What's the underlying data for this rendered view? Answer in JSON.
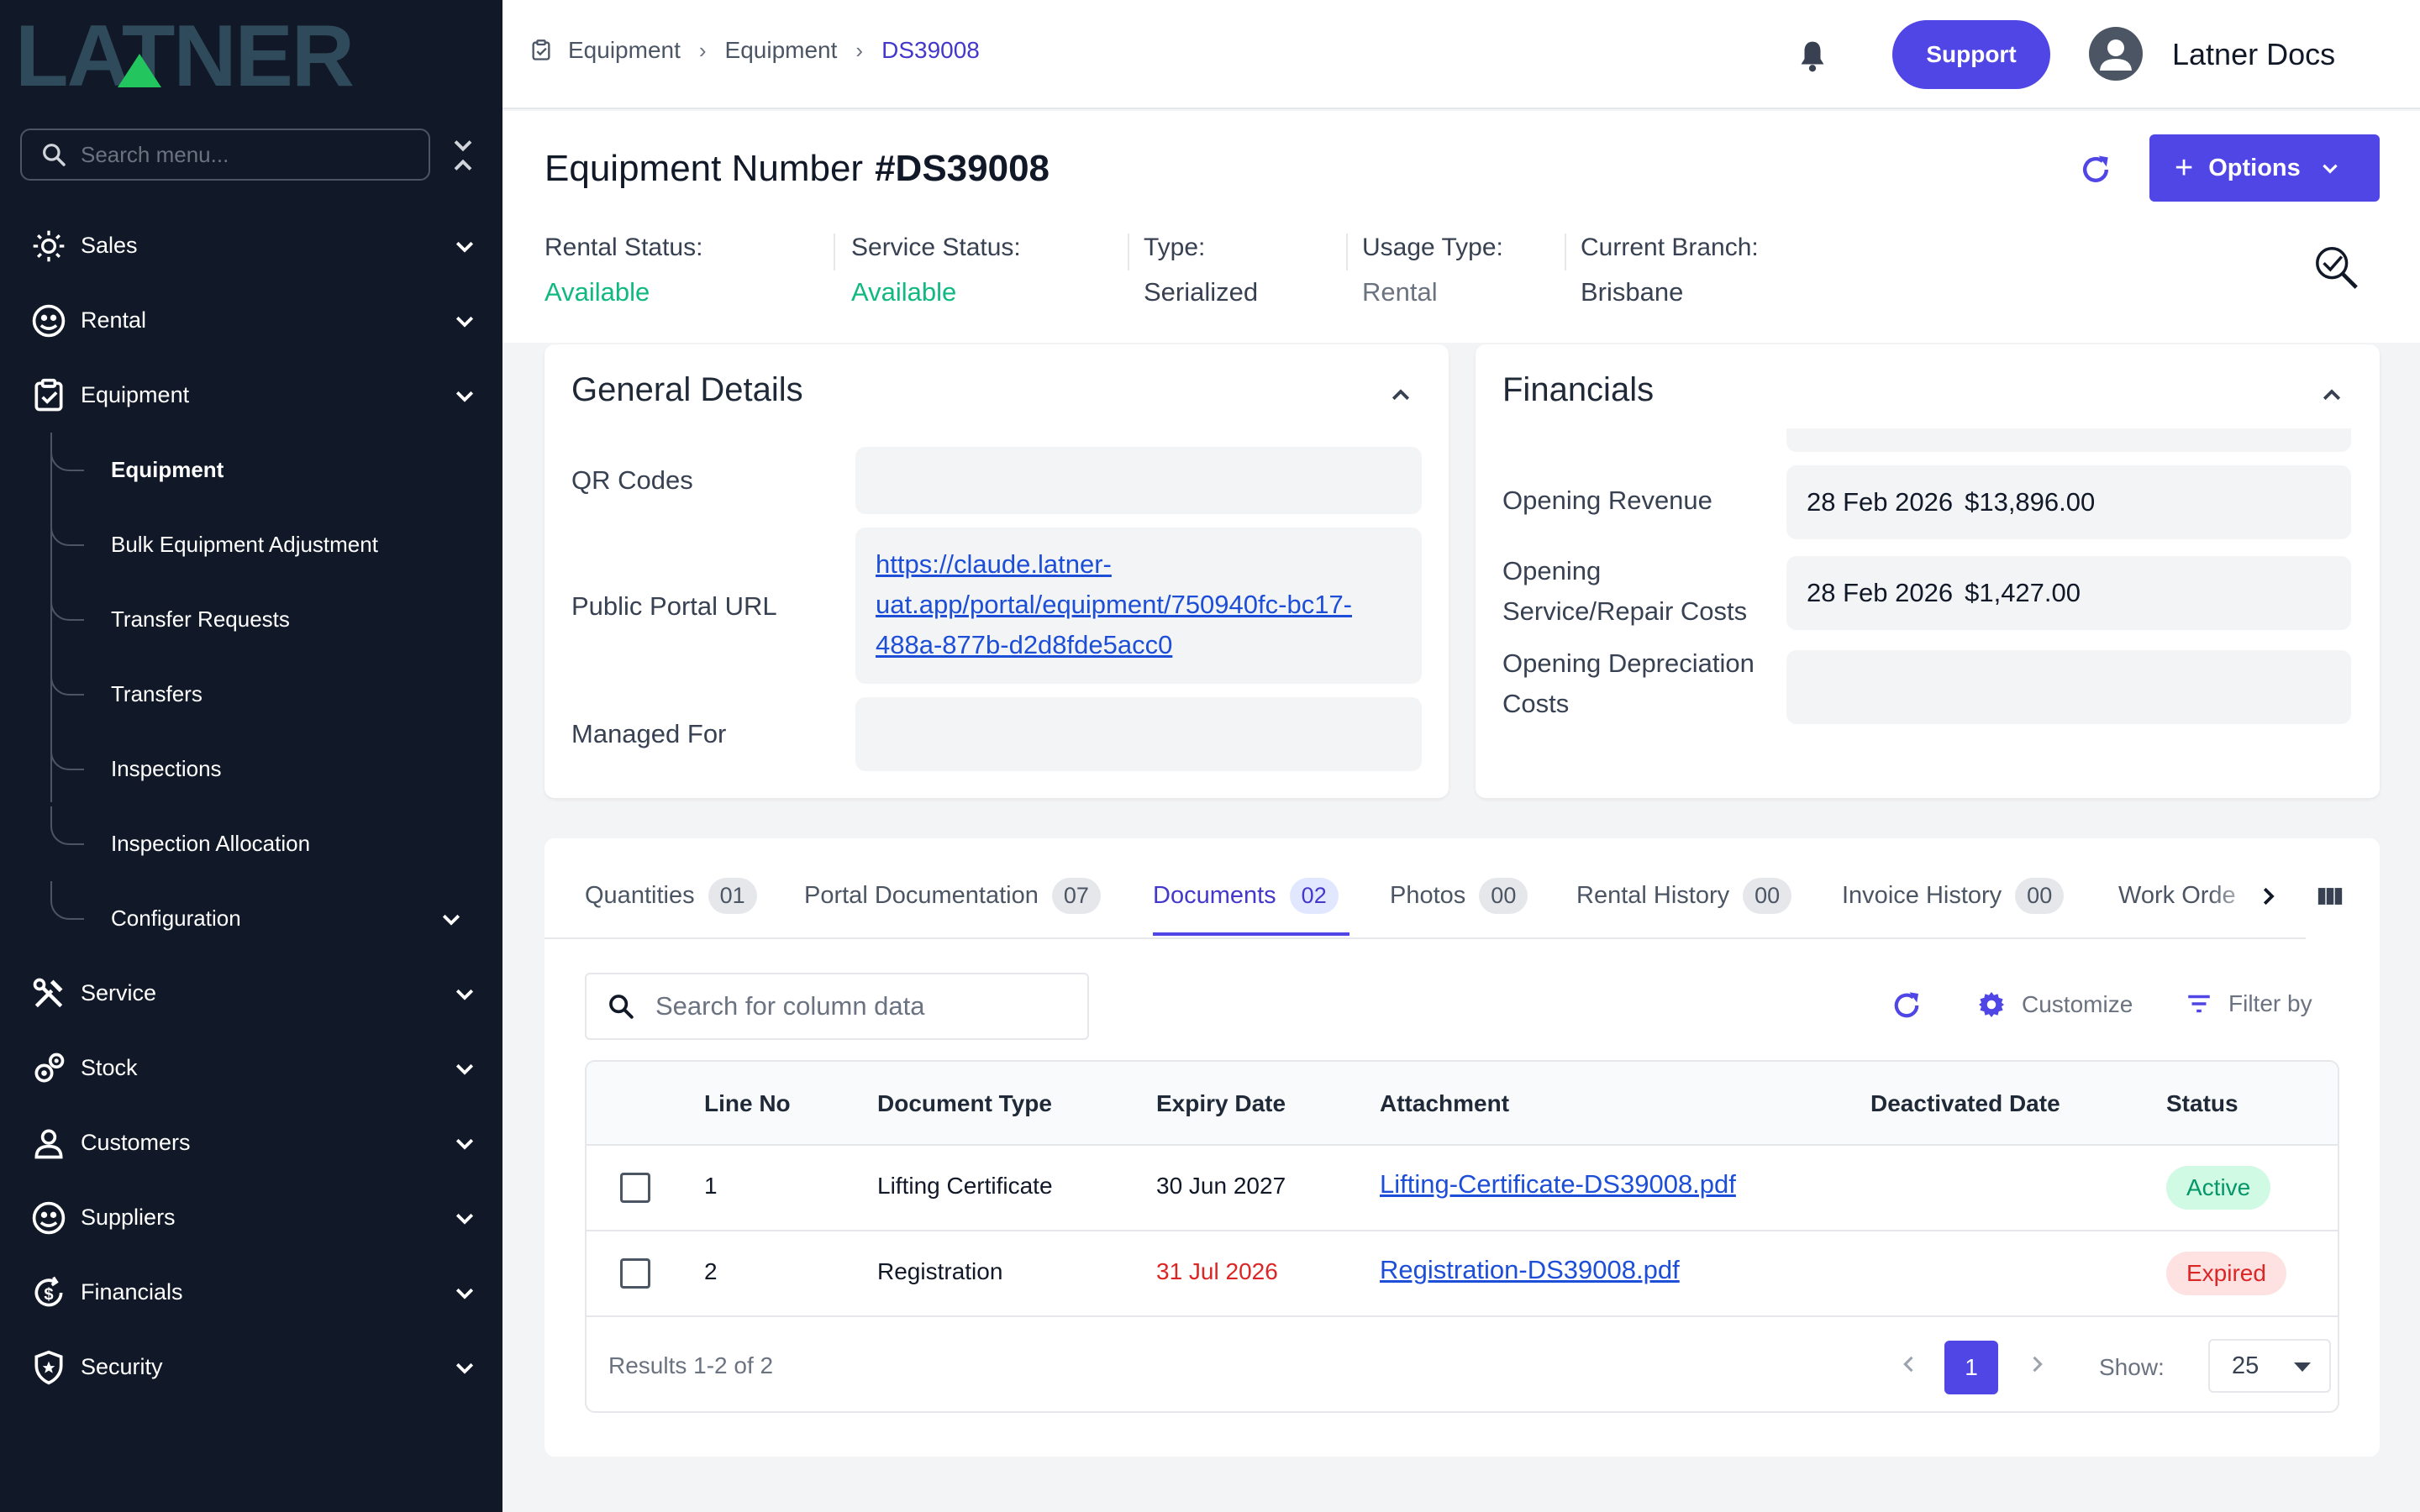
{
  "brand": {
    "logo_text": "LATNER",
    "accent_color": "#4f46e5"
  },
  "sidebar": {
    "search_placeholder": "Search menu...",
    "items": [
      {
        "label": "Sales",
        "icon": "sales-icon"
      },
      {
        "label": "Rental",
        "icon": "rental-icon"
      },
      {
        "label": "Equipment",
        "icon": "equipment-icon",
        "expanded": true,
        "children": [
          {
            "label": "Equipment",
            "active": true
          },
          {
            "label": "Bulk Equipment Adjustment"
          },
          {
            "label": "Transfer Requests"
          },
          {
            "label": "Transfers"
          },
          {
            "label": "Inspections"
          },
          {
            "label": "Inspection Allocation"
          },
          {
            "label": "Configuration"
          }
        ]
      },
      {
        "label": "Service",
        "icon": "service-icon"
      },
      {
        "label": "Stock",
        "icon": "stock-icon"
      },
      {
        "label": "Customers",
        "icon": "customers-icon"
      },
      {
        "label": "Suppliers",
        "icon": "suppliers-icon"
      },
      {
        "label": "Financials",
        "icon": "financials-icon"
      },
      {
        "label": "Security",
        "icon": "security-icon"
      }
    ]
  },
  "topbar": {
    "breadcrumb": [
      "Equipment",
      "Equipment",
      "DS39008"
    ],
    "support_label": "Support",
    "user_name": "Latner Docs"
  },
  "header": {
    "title_prefix": "Equipment Number",
    "title_number": "#DS39008",
    "options_label": "Options",
    "statuses": [
      {
        "label": "Rental Status:",
        "value": "Available"
      },
      {
        "label": "Service Status:",
        "value": "Available"
      },
      {
        "label": "Type:",
        "value": "Serialized"
      },
      {
        "label": "Usage Type:",
        "value": "Rental"
      },
      {
        "label": "Current Branch:",
        "value": "Brisbane"
      }
    ]
  },
  "general_details": {
    "title": "General Details",
    "qr_label": "QR Codes",
    "qr_value": "",
    "portal_label": "Public Portal URL",
    "portal_url": "https://claude.latner-uat.app/portal/equipment/750940fc-bc17-488a-877b-d2d8fde5acc0",
    "portal_url_lines": [
      "https://claude.latner-",
      "uat.app/portal/equipment/750940fc-bc17-",
      "488a-877b-d2d8fde5acc0"
    ],
    "managed_label": "Managed For",
    "managed_value": ""
  },
  "financials": {
    "title": "Financials",
    "rows": [
      {
        "label": "Opening Revenue",
        "date": "28 Feb 2026",
        "amount": "$13,896.00"
      },
      {
        "label_line1": "Opening",
        "label_line2": "Service/Repair Costs",
        "date": "28 Feb 2026",
        "amount": "$1,427.00"
      },
      {
        "label_line1": "Opening Depreciation",
        "label_line2": "Costs",
        "date": "",
        "amount": ""
      }
    ]
  },
  "tabs": [
    {
      "label": "Quantities",
      "count": "01"
    },
    {
      "label": "Portal Documentation",
      "count": "07"
    },
    {
      "label": "Documents",
      "count": "02",
      "active": true
    },
    {
      "label": "Photos",
      "count": "00"
    },
    {
      "label": "Rental History",
      "count": "00"
    },
    {
      "label": "Invoice History",
      "count": "00"
    },
    {
      "label": "Work Orde",
      "count": ""
    }
  ],
  "table": {
    "search_placeholder": "Search for column data",
    "customize_label": "Customize",
    "filter_label": "Filter by",
    "columns": [
      "Line No",
      "Document Type",
      "Expiry Date",
      "Attachment",
      "Deactivated Date",
      "Status"
    ],
    "rows": [
      {
        "line": "1",
        "type": "Lifting Certificate",
        "expiry": "30 Jun 2027",
        "attachment": "Lifting-Certificate-DS39008.pdf",
        "deactivated": "",
        "status": "Active"
      },
      {
        "line": "2",
        "type": "Registration",
        "expiry": "31 Jul 2026",
        "attachment": "Registration-DS39008.pdf",
        "deactivated": "",
        "status": "Expired"
      }
    ],
    "results_text": "Results 1-2 of 2",
    "current_page": "1",
    "show_label": "Show:",
    "page_size": "25"
  }
}
